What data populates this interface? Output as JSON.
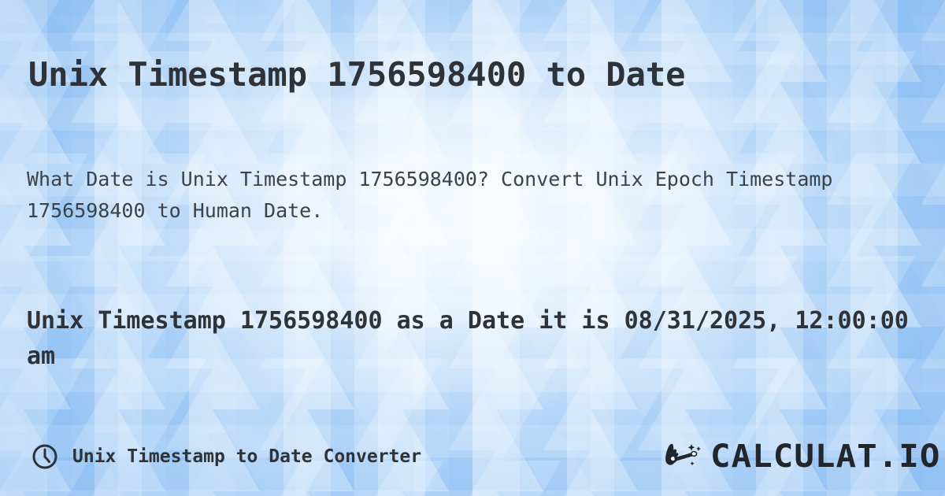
{
  "meta": {
    "timestamp": "1756598400",
    "accent_color": "#9ec9f6",
    "text_color": "#2f3338",
    "muted_text_color": "#3c4249"
  },
  "header": {
    "title": "Unix Timestamp 1756598400 to Date"
  },
  "main": {
    "description": "What Date is Unix Timestamp 1756598400? Convert Unix Epoch Timestamp 1756598400 to Human Date.",
    "result": "Unix Timestamp 1756598400 as a Date it is 08/31/2025, 12:00:00 am",
    "result_date": "08/31/2025",
    "result_time": "12:00:00 am"
  },
  "footer": {
    "clock_icon": "clock-icon",
    "label": "Unix Timestamp to Date Converter",
    "brand": {
      "wand_icon": "magic-wand-hand-icon",
      "name": "CALCULAT.IO"
    }
  }
}
